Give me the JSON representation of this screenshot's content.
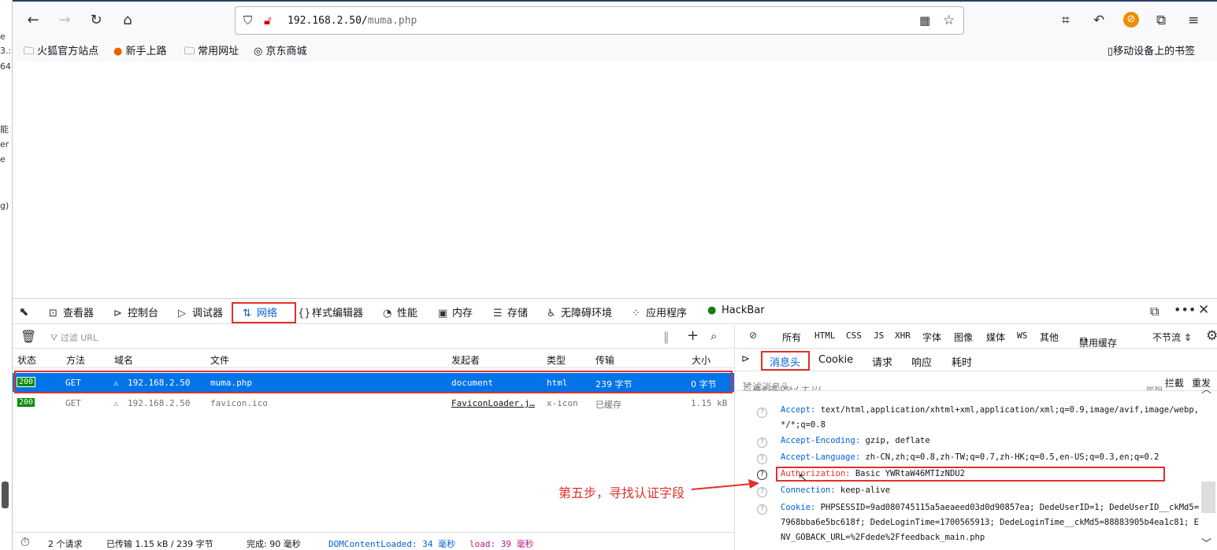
{
  "left_window": {
    "fragments": [
      "e",
      "3.:",
      "64",
      "能",
      "er",
      "e",
      "g)"
    ]
  },
  "browser": {
    "url_host": "192.168.2.50/",
    "url_path": "muma.php",
    "bookmarks": [
      "火狐官方站点",
      "新手上路",
      "常用网址",
      "京东商城"
    ],
    "mobile_bookmarks": "移动设备上的书签"
  },
  "devtools": {
    "tabs": [
      {
        "label": "查看器"
      },
      {
        "label": "控制台"
      },
      {
        "label": "调试器"
      },
      {
        "label": "网络"
      },
      {
        "label": "样式编辑器"
      },
      {
        "label": "性能"
      },
      {
        "label": "内存"
      },
      {
        "label": "存储"
      },
      {
        "label": "无障碍环境"
      },
      {
        "label": "应用程序"
      },
      {
        "label": "HackBar"
      }
    ],
    "filter_placeholder": "过滤 URL",
    "type_filters": [
      "所有",
      "HTML",
      "CSS",
      "JS",
      "XHR",
      "字体",
      "图像",
      "媒体",
      "WS",
      "其他"
    ],
    "disable_cache": "禁用缓存",
    "throttle": "不节流 ⇕",
    "columns": [
      "状态",
      "方法",
      "域名",
      "文件",
      "发起者",
      "类型",
      "传输",
      "大小"
    ],
    "requests": [
      {
        "status": "200",
        "method": "GET",
        "domain": "192.168.2.50",
        "file": "muma.php",
        "initiator": "document",
        "type": "html",
        "transfer": "239 字节",
        "size": "0 字节"
      },
      {
        "status": "200",
        "method": "GET",
        "domain": "192.168.2.50",
        "file": "favicon.ico",
        "initiator": "FaviconLoader.j…",
        "type": "x-icon",
        "transfer": "已缓存",
        "size": "1.15 kB"
      }
    ],
    "status": {
      "requests": "2 个请求",
      "transferred": "已传输 1.15 kB / 239 字节",
      "finish": "完成: 90 毫秒",
      "dcl": "DOMContentLoaded: 34 毫秒",
      "load": "load: 39 毫秒"
    },
    "side_tabs": [
      "消息头",
      "Cookie",
      "请求",
      "响应",
      "耗时"
    ],
    "side_filter_placeholder": "过滤消息头",
    "block": "拦截",
    "resend": "重发",
    "headers_cut": "请求头 (615 字节)",
    "raw_cut": "原始",
    "headers": [
      {
        "k": "Accept:",
        "v": " text/html,application/xhtml+xml,application/xml;q=0.9,image/avif,image/webp,",
        "v2": "*/*;q=0.8"
      },
      {
        "k": "Accept-Encoding:",
        "v": " gzip, deflate"
      },
      {
        "k": "Accept-Language:",
        "v": " zh-CN,zh;q=0.8,zh-TW;q=0.7,zh-HK;q=0.5,en-US;q=0.3,en;q=0.2"
      },
      {
        "k": "Authorization:",
        "v": " Basic YWRtaW46MTIzNDU2"
      },
      {
        "k": "Connection:",
        "v": " keep-alive"
      },
      {
        "k": "Cookie:",
        "v": " PHPSESSID=9ad080745115a5aeaeed03d0d90857ea; DedeUserID=1; DedeUserID__ckMd5=",
        "v2": "7968bba6e5bc618f; DedeLoginTime=1700565913; DedeLoginTime__ckMd5=88883905b4ea1c81; E",
        "v3": "NV_GOBACK_URL=%2Fdede%2Ffeedback_main.php"
      }
    ]
  },
  "annotation": "第五步，寻找认证字段",
  "colors": {
    "accent": "#0060df",
    "highlight": "#e0302b",
    "selected_row": "#0074e8",
    "status_ok": "#058b00"
  }
}
